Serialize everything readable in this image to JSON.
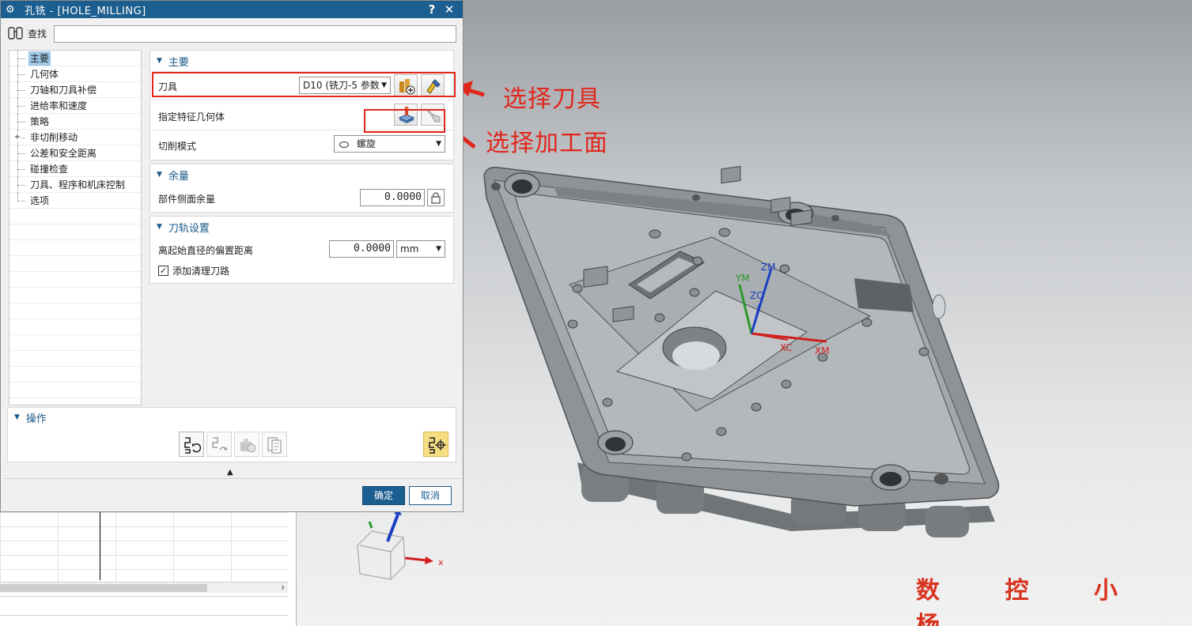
{
  "dialog": {
    "title": "孔铣 - [HOLE_MILLING]",
    "help": "?",
    "close": "✕",
    "find_label": "查找",
    "find_value": ""
  },
  "nav": {
    "items": [
      {
        "label": "主要",
        "selected": true
      },
      {
        "label": "几何体"
      },
      {
        "label": "刀轴和刀具补偿"
      },
      {
        "label": "进给率和速度"
      },
      {
        "label": "策略"
      },
      {
        "label": "非切削移动",
        "expander": "+"
      },
      {
        "label": "公差和安全距离"
      },
      {
        "label": "碰撞检查"
      },
      {
        "label": "刀具、程序和机床控制"
      },
      {
        "label": "选项"
      }
    ]
  },
  "main_section": {
    "title": "主要",
    "tool_label": "刀具",
    "tool_value": "D10 (铣刀-5 参数",
    "feature_geom_label": "指定特征几何体",
    "cut_mode_label": "切削模式",
    "cut_mode_value": "螺旋"
  },
  "stock_section": {
    "title": "余量",
    "side_stock_label": "部件侧面余量",
    "side_stock_value": "0.0000"
  },
  "path_section": {
    "title": "刀轨设置",
    "offset_label": "离起始直径的偏置距离",
    "offset_value": "0.0000",
    "unit_value": "mm",
    "cleanup_label": "添加清理刀路",
    "cleanup_checked": "✓"
  },
  "ops_section": {
    "title": "操作"
  },
  "buttons": {
    "ok": "确定",
    "cancel": "取消"
  },
  "annotations": {
    "select_tool": "选择刀具",
    "select_face": "选择加工面"
  },
  "watermark": "数 控 小 杨",
  "viewport": {
    "axis_labels": [
      "ZM",
      "ZC",
      "YM",
      "XC",
      "XM"
    ],
    "triad_x": "x"
  },
  "colors": {
    "titlebar": "#1c5e8f",
    "selected_nav": "#9ec9e7",
    "annotation_red": "#e1261c",
    "part_gray": "#8d9296"
  }
}
